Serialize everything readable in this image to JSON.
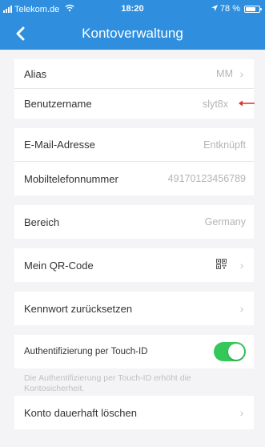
{
  "status_bar": {
    "carrier": "Telekom.de",
    "time": "18:20",
    "battery_text": "78 %",
    "battery_level": 0.78
  },
  "nav": {
    "title": "Kontoverwaltung",
    "back_icon": "chevron-left-icon"
  },
  "account": {
    "alias_label": "Alias",
    "alias_value": "MM",
    "username_label": "Benutzername",
    "username_value": "slyt8x",
    "email_label": "E-Mail-Adresse",
    "email_value": "Entknüpft",
    "mobile_label": "Mobiltelefonnummer",
    "mobile_value": "49170123456789",
    "region_label": "Bereich",
    "region_value": "Germany",
    "qr_label": "Mein QR-Code",
    "reset_label": "Kennwort zurücksetzen",
    "touchid_label": "Authentifizierung per Touch-ID",
    "touchid_enabled": true,
    "touchid_desc": "Die Authentifizierung per Touch-ID erhöht die Kontosicherheit.",
    "delete_label": "Konto dauerhaft löschen"
  },
  "colors": {
    "header": "#2f8fde",
    "toggle_on": "#34c759",
    "annotation": "#d9342b"
  }
}
